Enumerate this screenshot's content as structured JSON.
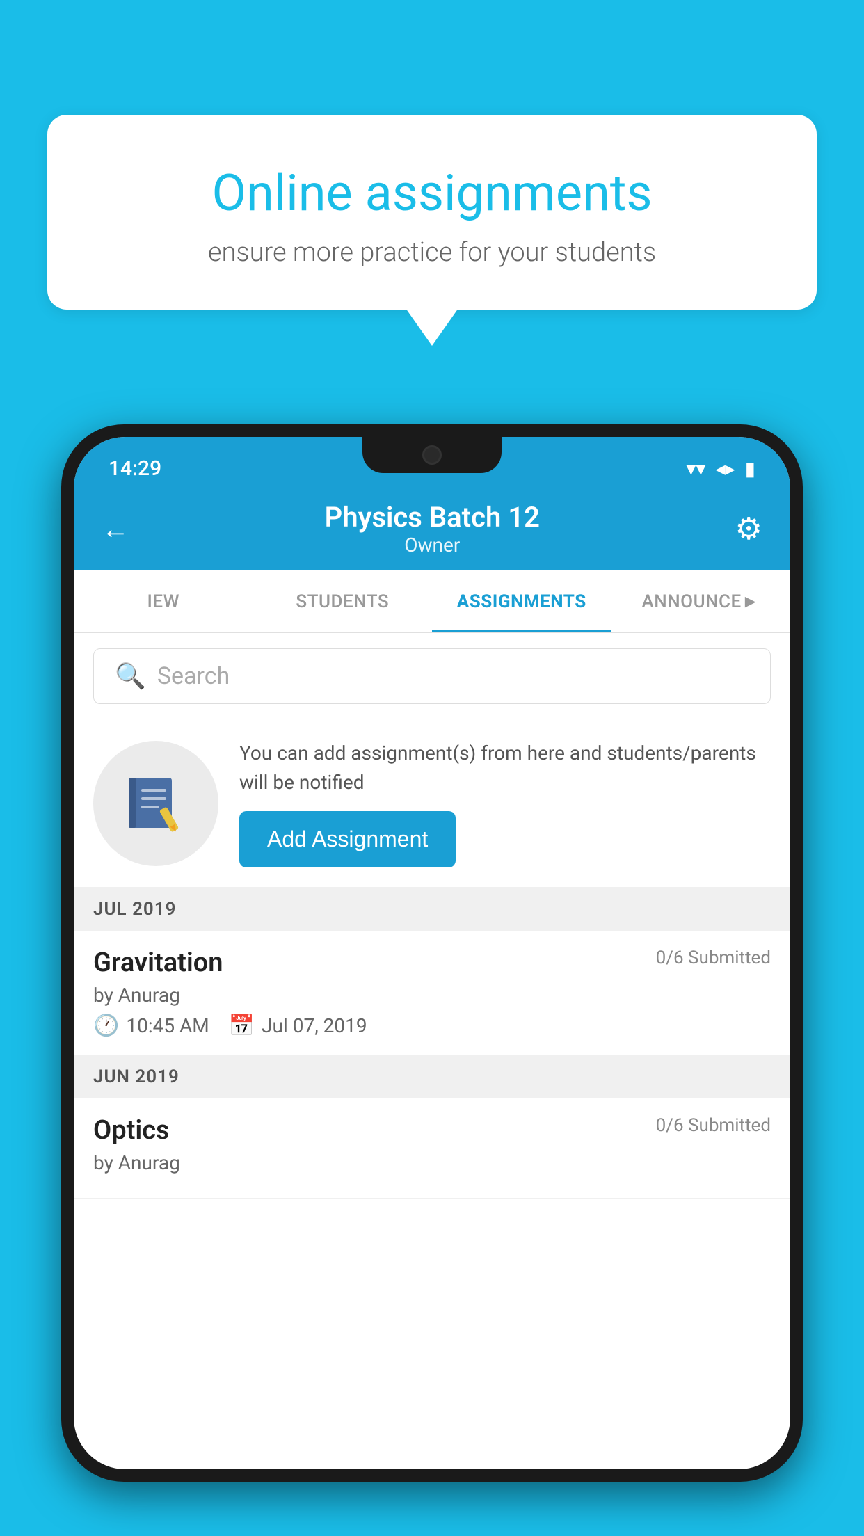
{
  "background_color": "#1ABDE8",
  "speech_bubble": {
    "title": "Online assignments",
    "subtitle": "ensure more practice for your students"
  },
  "status_bar": {
    "time": "14:29",
    "wifi": "▼",
    "signal": "▲",
    "battery": "▮"
  },
  "header": {
    "title": "Physics Batch 12",
    "subtitle": "Owner",
    "back_label": "←",
    "gear_label": "⚙"
  },
  "tabs": [
    {
      "label": "IEW",
      "active": false
    },
    {
      "label": "STUDENTS",
      "active": false
    },
    {
      "label": "ASSIGNMENTS",
      "active": true
    },
    {
      "label": "ANNOUNCE►",
      "active": false
    }
  ],
  "search": {
    "placeholder": "Search",
    "icon": "🔍"
  },
  "add_assignment_section": {
    "description": "You can add assignment(s) from here and students/parents will be notified",
    "button_label": "Add Assignment",
    "icon": "📓"
  },
  "sections": [
    {
      "label": "JUL 2019",
      "items": [
        {
          "name": "Gravitation",
          "status": "0/6 Submitted",
          "by": "by Anurag",
          "time": "10:45 AM",
          "date": "Jul 07, 2019"
        }
      ]
    },
    {
      "label": "JUN 2019",
      "items": [
        {
          "name": "Optics",
          "status": "0/6 Submitted",
          "by": "by Anurag",
          "time": "",
          "date": ""
        }
      ]
    }
  ]
}
